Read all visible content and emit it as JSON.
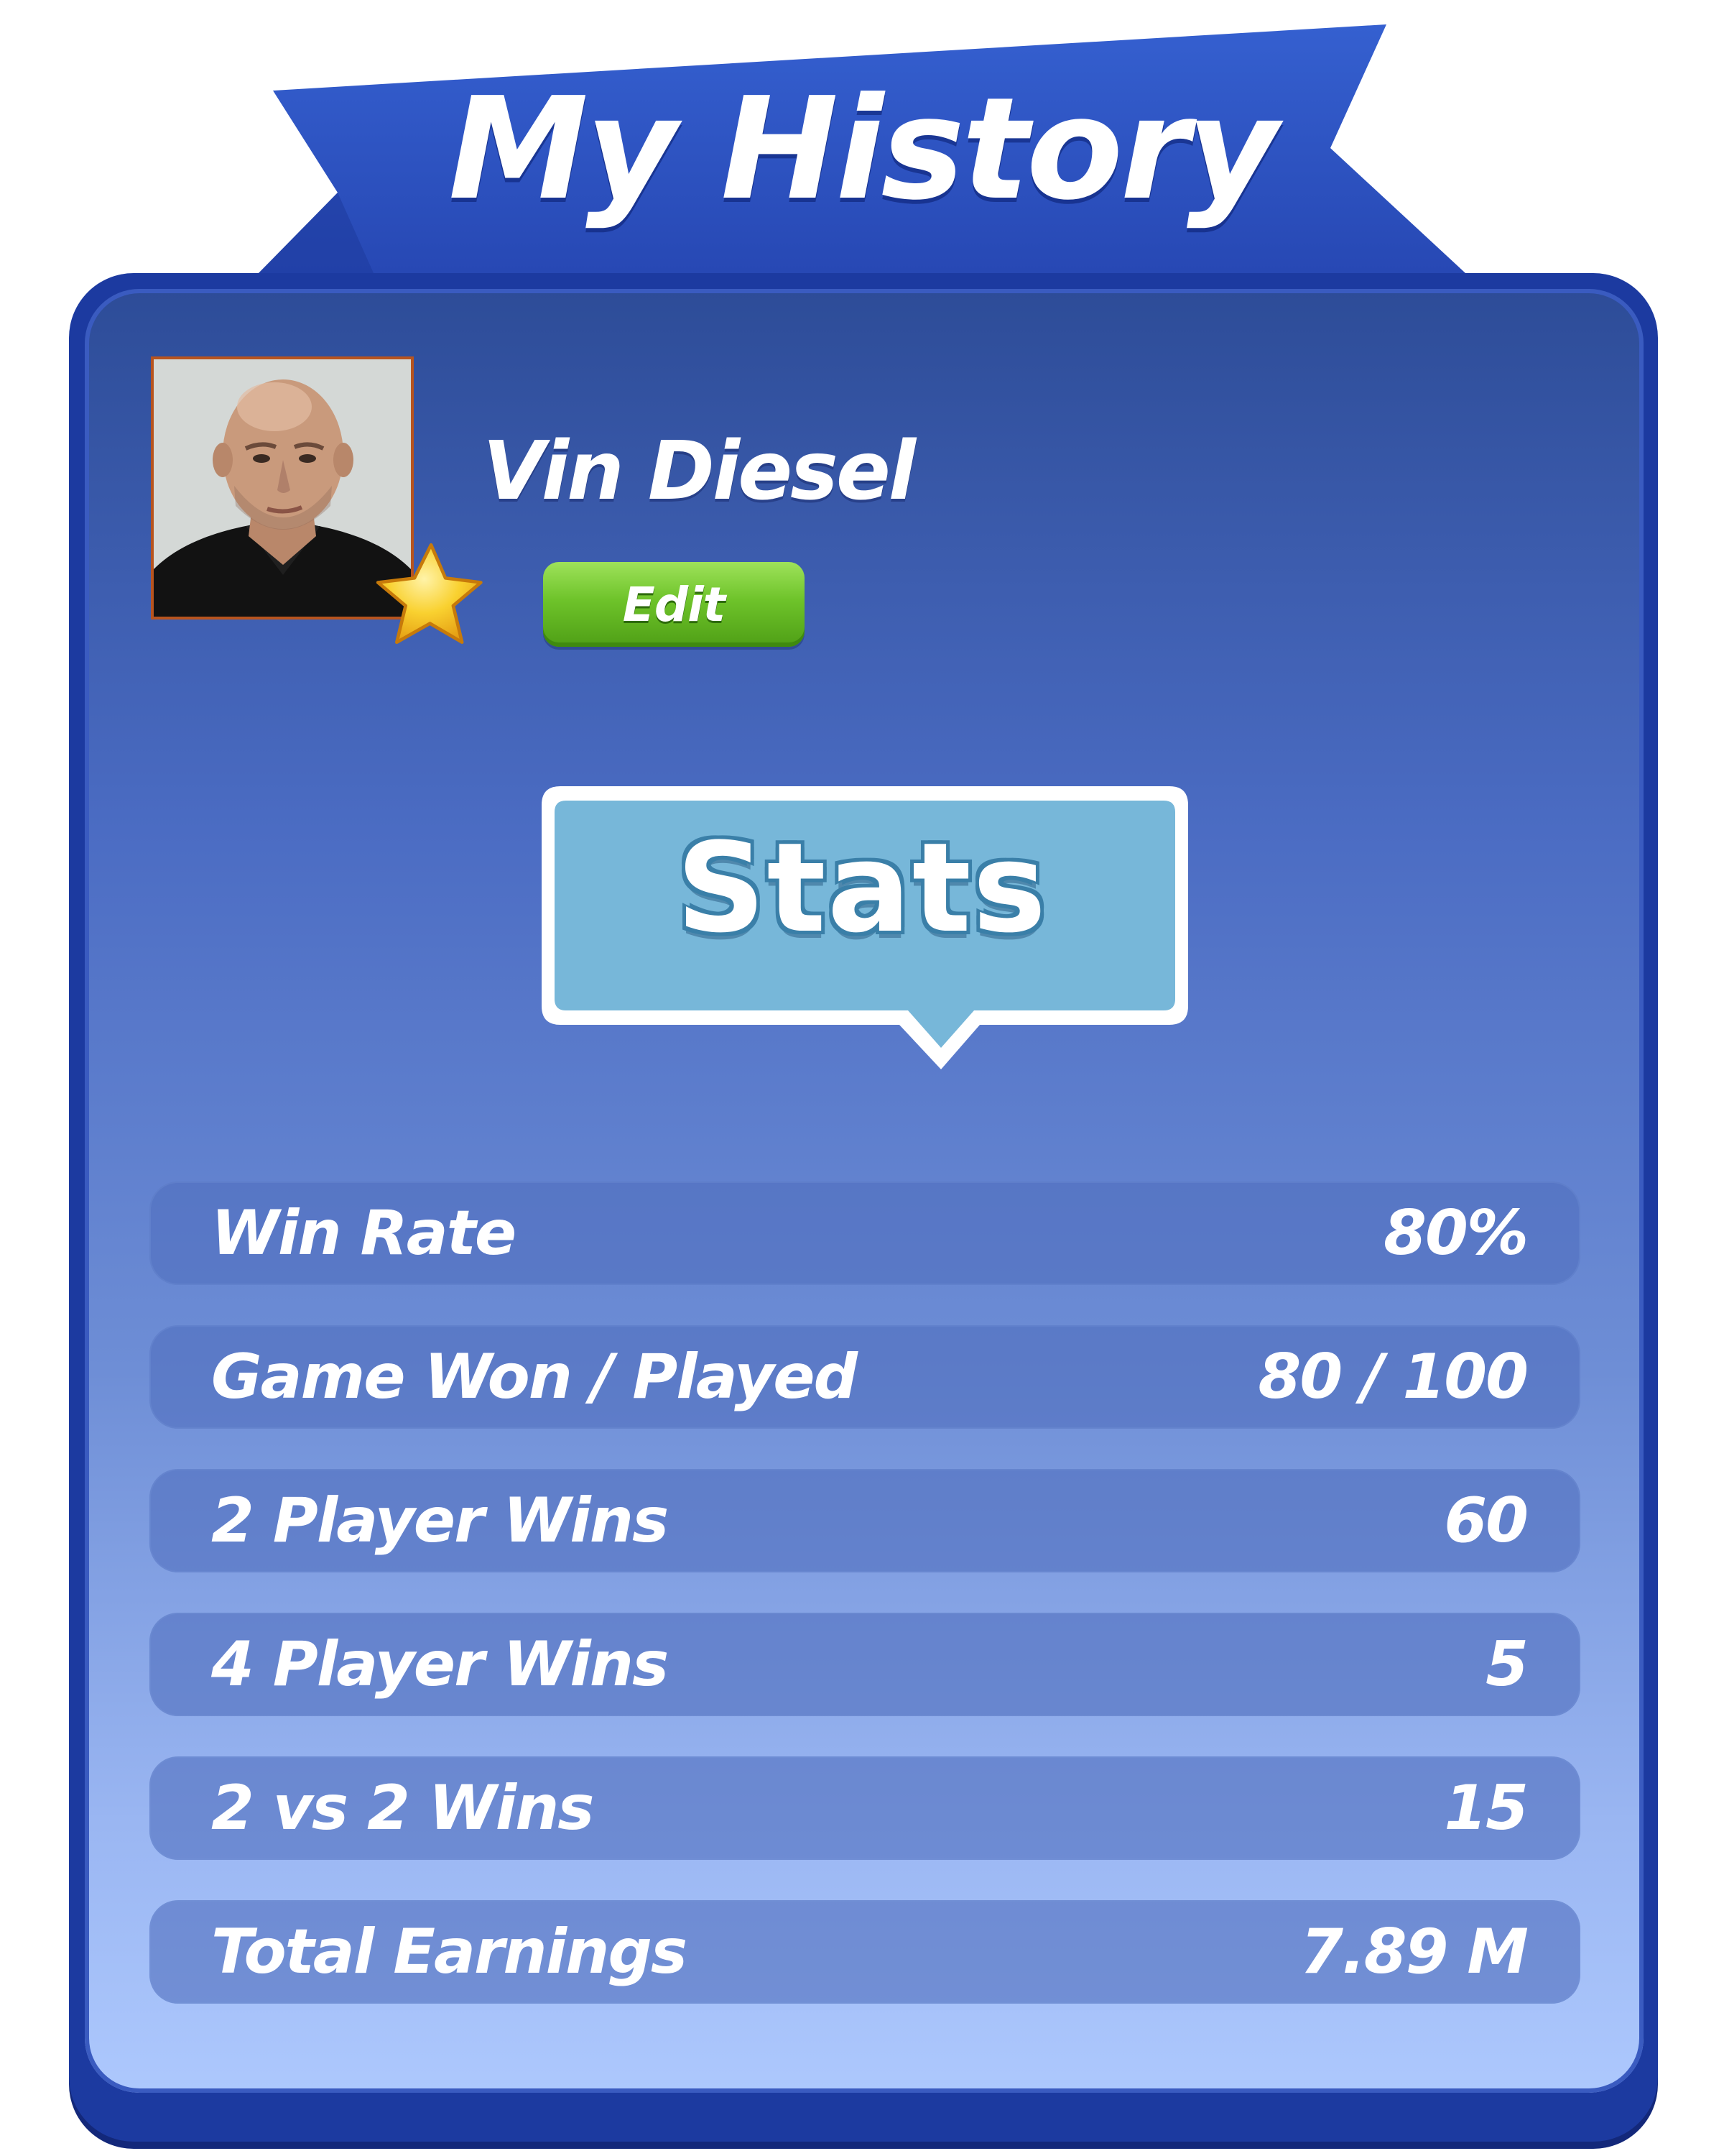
{
  "banner": {
    "title": "My History"
  },
  "profile": {
    "name": "Vin Diesel",
    "edit_label": "Edit",
    "avatar_icon": "player-portrait",
    "badge_icon": "star-icon"
  },
  "stats": {
    "heading": "Stats",
    "rows": [
      {
        "label": "Win Rate",
        "value": "80%"
      },
      {
        "label": "Game Won / Played",
        "value": "80 / 100"
      },
      {
        "label": "2 Player Wins",
        "value": "60"
      },
      {
        "label": "4 Player Wins",
        "value": "5"
      },
      {
        "label": "2 vs 2 Wins",
        "value": "15"
      },
      {
        "label": "Total Earnings",
        "value": "7.89 M"
      }
    ]
  },
  "colors": {
    "banner_blue": "#2d4fc2",
    "panel_border": "#1c3aa0",
    "panel_top": "#2d4c98",
    "panel_bottom": "#adc8fd",
    "edit_green": "#6ec32a",
    "bubble_blue": "#79b6d8",
    "star_yellow": "#f7c21a"
  }
}
